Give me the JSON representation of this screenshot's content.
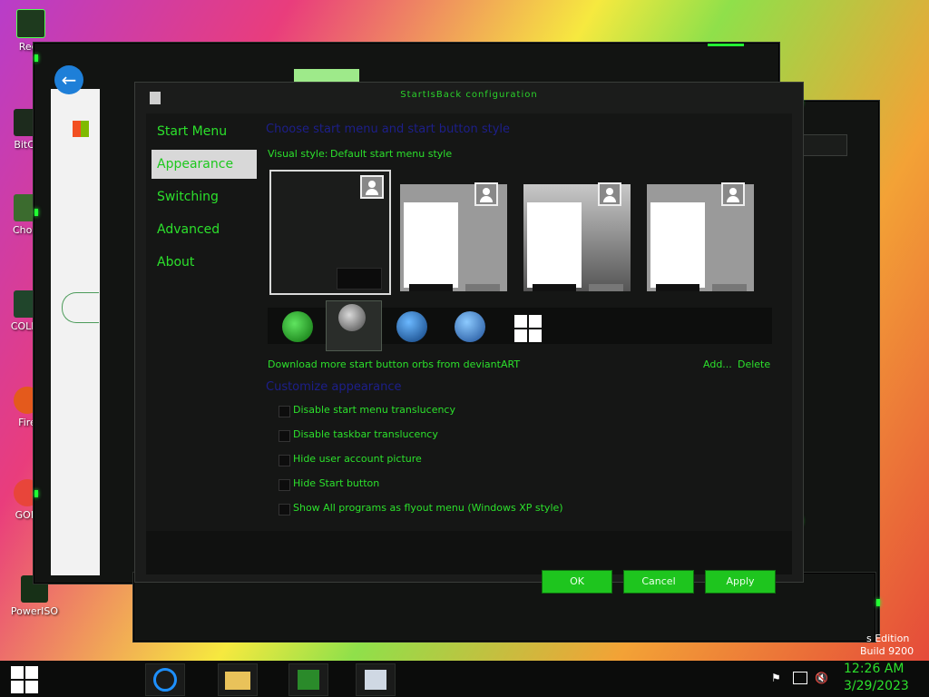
{
  "desktop": {
    "icons": [
      {
        "label": "Recy"
      },
      {
        "label": "BitCo"
      },
      {
        "label": "Chom"
      },
      {
        "label": "COLLA"
      },
      {
        "label": "Fire"
      },
      {
        "label": "GOM"
      },
      {
        "label": "PowerISO"
      }
    ],
    "watermark": {
      "edition": "s Edition",
      "build": "Build 9200"
    }
  },
  "dialog": {
    "title": "StartIsBack configuration",
    "nav": [
      {
        "label": "Start Menu"
      },
      {
        "label": "Appearance"
      },
      {
        "label": "Switching"
      },
      {
        "label": "Advanced"
      },
      {
        "label": "About"
      }
    ],
    "heading1": "Choose start menu and start button style",
    "visual_style_label": "Visual style:",
    "visual_style_value": "Default start menu style",
    "download_link": "Download more start button orbs from deviantART",
    "add_link": "Add...",
    "delete_link": "Delete",
    "heading2": "Customize appearance",
    "options": [
      {
        "label": "Disable start menu translucency",
        "checked": false
      },
      {
        "label": "Disable taskbar translucency",
        "checked": false
      },
      {
        "label": "Hide user account picture",
        "checked": false
      },
      {
        "label": "Hide Start button",
        "checked": false
      },
      {
        "label": "Show All programs as flyout menu (Windows XP style)",
        "checked": false
      }
    ],
    "ok": "OK",
    "cancel": "Cancel",
    "apply": "Apply"
  },
  "taskbar": {
    "time": "12:26 AM",
    "date": "3/29/2023"
  },
  "colors": {
    "accent": "#2ce02c",
    "heading": "#1d1f8a"
  }
}
